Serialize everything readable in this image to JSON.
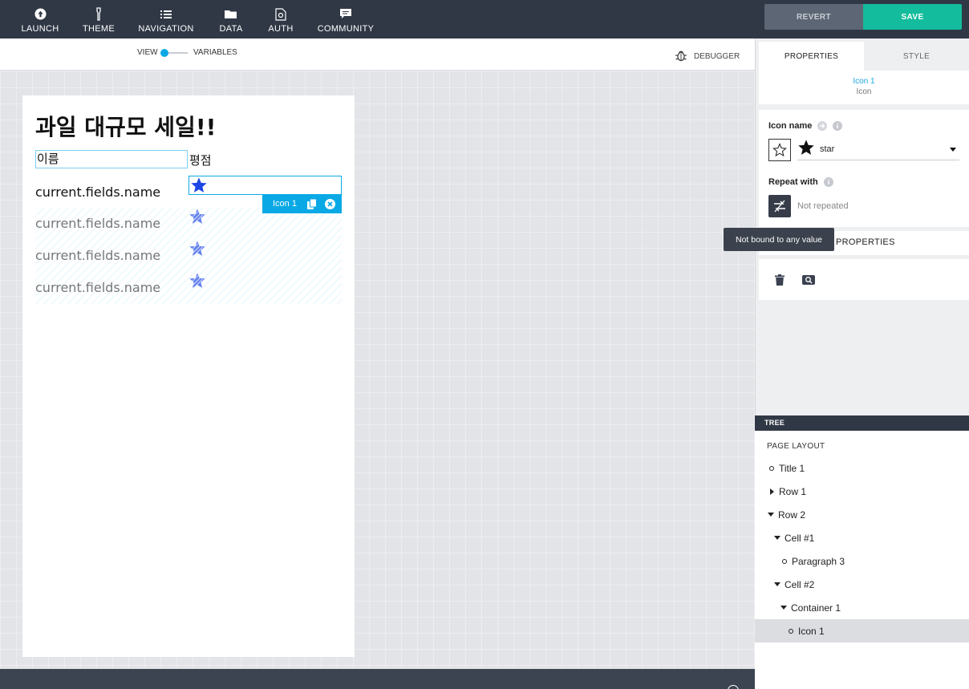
{
  "topnav": {
    "items": [
      {
        "label": "LAUNCH",
        "icon": "launch-icon"
      },
      {
        "label": "THEME",
        "icon": "theme-icon"
      },
      {
        "label": "NAVIGATION",
        "icon": "navigation-icon"
      },
      {
        "label": "DATA",
        "icon": "data-icon"
      },
      {
        "label": "AUTH",
        "icon": "auth-icon"
      },
      {
        "label": "COMMUNITY",
        "icon": "community-icon"
      }
    ],
    "revert_label": "REVERT",
    "save_label": "SAVE"
  },
  "subbar": {
    "view_label": "VIEW",
    "variables_label": "VARIABLES",
    "debugger_label": "DEBUGGER"
  },
  "canvas": {
    "title": "과일 대규모 세일!!",
    "col_name": "이름",
    "col_rating": "평점",
    "rows": [
      "current.fields.name",
      "current.fields.name",
      "current.fields.name",
      "current.fields.name"
    ],
    "selected_tag": "Icon 1"
  },
  "panel": {
    "tab_properties": "PROPERTIES",
    "tab_style": "STYLE",
    "selected_name": "Icon 1",
    "selected_type": "Icon",
    "icon_name_label": "Icon name",
    "icon_value": "star",
    "repeat_label": "Repeat with",
    "repeat_value": "Not repeated",
    "advanced_label": "PROPERTIES",
    "tooltip": "Not bound to any value"
  },
  "tree": {
    "header": "TREE",
    "title": "PAGE LAYOUT",
    "nodes": [
      {
        "label": "Title 1",
        "marker": "dot",
        "depth": 0
      },
      {
        "label": "Row 1",
        "marker": "collapsed",
        "depth": 0
      },
      {
        "label": "Row 2",
        "marker": "expanded",
        "depth": 0
      },
      {
        "label": "Cell #1",
        "marker": "expanded",
        "depth": 1
      },
      {
        "label": "Paragraph 3",
        "marker": "dot",
        "depth": 2
      },
      {
        "label": "Cell #2",
        "marker": "expanded",
        "depth": 1
      },
      {
        "label": "Container 1",
        "marker": "expanded",
        "depth": 2
      },
      {
        "label": "Icon 1",
        "marker": "dot",
        "depth": 3,
        "selected": true
      }
    ]
  },
  "colors": {
    "topbar": "#303846",
    "accent": "#0aa9e5",
    "save": "#13bc9c",
    "revert": "#5d6675"
  }
}
